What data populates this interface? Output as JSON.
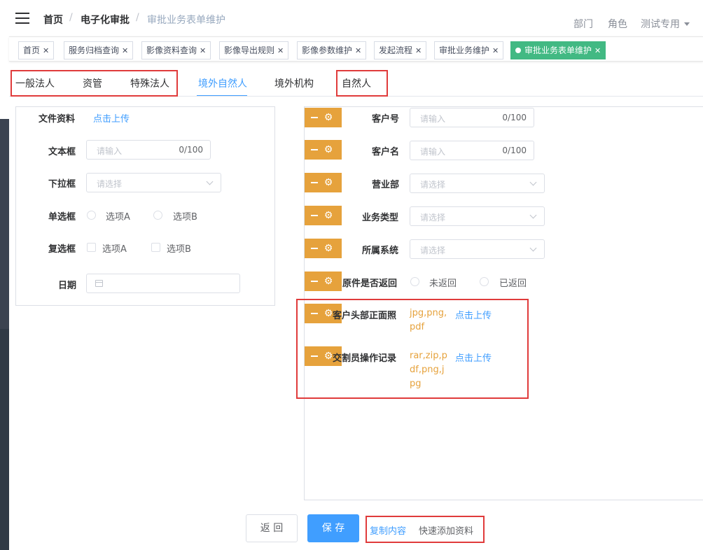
{
  "breadcrumb": [
    "首页",
    "电子化审批",
    "审批业务表单维护"
  ],
  "header_right": {
    "dept": "部门",
    "role": "角色",
    "user": "测试专用"
  },
  "tags": [
    "首页",
    "服务归档查询",
    "影像资料查询",
    "影像导出规则",
    "影像参数维护",
    "发起流程",
    "审批业务维护",
    "审批业务表单维护"
  ],
  "type_tabs": [
    "一般法人",
    "资管",
    "特殊法人",
    "境外自然人",
    "境外机构",
    "自然人"
  ],
  "left_form": {
    "file_label": "文件资料",
    "upload_link": "点击上传",
    "text_label": "文本框",
    "text_placeholder": "请输入",
    "text_count": "0/100",
    "select_label": "下拉框",
    "select_placeholder": "请选择",
    "radio_label": "单选框",
    "radio_options": [
      "选项A",
      "选项B"
    ],
    "checkbox_label": "复选框",
    "checkbox_options": [
      "选项A",
      "选项B"
    ],
    "date_label": "日期"
  },
  "right_form": {
    "customer_no": {
      "label": "客户号",
      "placeholder": "请输入",
      "count": "0/100"
    },
    "customer_name": {
      "label": "客户名",
      "placeholder": "请输入",
      "count": "0/100"
    },
    "branch": {
      "label": "营业部",
      "placeholder": "请选择"
    },
    "business_type": {
      "label": "业务类型",
      "placeholder": "请选择"
    },
    "system": {
      "label": "所属系统",
      "placeholder": "请选择"
    },
    "original_returned": {
      "label": "原件是否返回",
      "options": [
        "未返回",
        "已返回"
      ]
    },
    "head_photo": {
      "label": "客户头部正面照",
      "types": "jpg,png,\npdf",
      "upload": "点击上传"
    },
    "handover": {
      "label": "交割员操作记录",
      "types": "rar,zip,p\ndf,png,j\npg",
      "upload": "点击上传"
    }
  },
  "buttons": {
    "back": "返 回",
    "save": "保 存",
    "copy": "复制内容",
    "quick_add": "快速添加资料"
  },
  "colors": {
    "primary": "#409eff",
    "warning": "#e6a23c",
    "active_tag": "#42b983",
    "highlight_box": "#e03b3b"
  }
}
